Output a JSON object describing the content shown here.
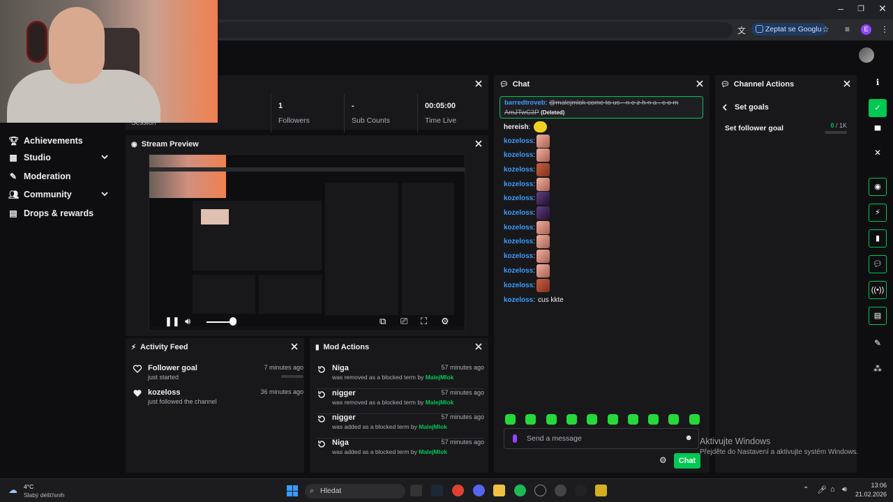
{
  "browser": {
    "ask_google": "Zeptat se Googlu",
    "profile_initial": "E"
  },
  "sidebar": {
    "items": [
      {
        "label": "Achievements",
        "icon": "trophy-icon"
      },
      {
        "label": "Studio",
        "icon": "film-icon"
      },
      {
        "label": "Moderation",
        "icon": "wrench-icon"
      },
      {
        "label": "Community",
        "icon": "people-icon"
      },
      {
        "label": "Drops & rewards",
        "icon": "gift-icon"
      }
    ],
    "partial_top_label": "Session"
  },
  "stats": [
    {
      "value": "1",
      "label": "Followers"
    },
    {
      "value": "-",
      "label": "Sub Counts"
    },
    {
      "value": "00:05:00",
      "label": "Time Live"
    }
  ],
  "stream_preview": {
    "title": "Stream Preview"
  },
  "activity_feed": {
    "title": "Activity Feed",
    "items": [
      {
        "title": "Follower goal",
        "sub": "just started",
        "time": "7 minutes ago",
        "icon": "heart-outline-icon"
      },
      {
        "title": "kozeloss",
        "sub": "just followed the channel",
        "time": "36 minutes ago",
        "icon": "heart-icon"
      }
    ]
  },
  "mod_actions": {
    "title": "Mod Actions",
    "items": [
      {
        "term": "Niga",
        "action": "was removed as a blocked term by",
        "mod": "MalejMlok",
        "time": "57 minutes ago"
      },
      {
        "term": "nigger",
        "action": "was removed as a blocked term by",
        "mod": "MalejMlok",
        "time": "57 minutes ago"
      },
      {
        "term": "nigger",
        "action": "was added as a blocked term by",
        "mod": "MalejMlok",
        "time": "57 minutes ago"
      },
      {
        "term": "Niga",
        "action": "was added as a blocked term by",
        "mod": "MalejMlok",
        "time": "57 minutes ago"
      }
    ]
  },
  "chat": {
    "title": "Chat",
    "deleted_user": "barredtroveb",
    "deleted_text": "@malejmlok come to us - n e z h n a . c o m",
    "deleted_text2": "AmJTwC3P",
    "deleted_tag": "(Deleted)",
    "hereish_user": "hereish",
    "emote_user": "kozeloss",
    "last_text": "cus kkte",
    "input_placeholder": "Send a message",
    "chat_button": "Chat"
  },
  "channel_actions": {
    "title": "Channel Actions",
    "back_label": "Set goals",
    "goal_label": "Set follower goal",
    "goal_current": "0",
    "goal_total": "/ 1K",
    "goal_progress": 0
  },
  "watermark": {
    "line1": "Aktivujte Windows",
    "line2": "Přejděte do Nastavení a aktivujte systém Windows."
  },
  "taskbar": {
    "weather_temp": "4°C",
    "weather_desc": "Slabý déšť/snih",
    "search": "Hledat",
    "time": "13:06",
    "date": "21.02.2026"
  },
  "colors": {
    "accent": "#00c853",
    "username": "#3b9cff"
  }
}
